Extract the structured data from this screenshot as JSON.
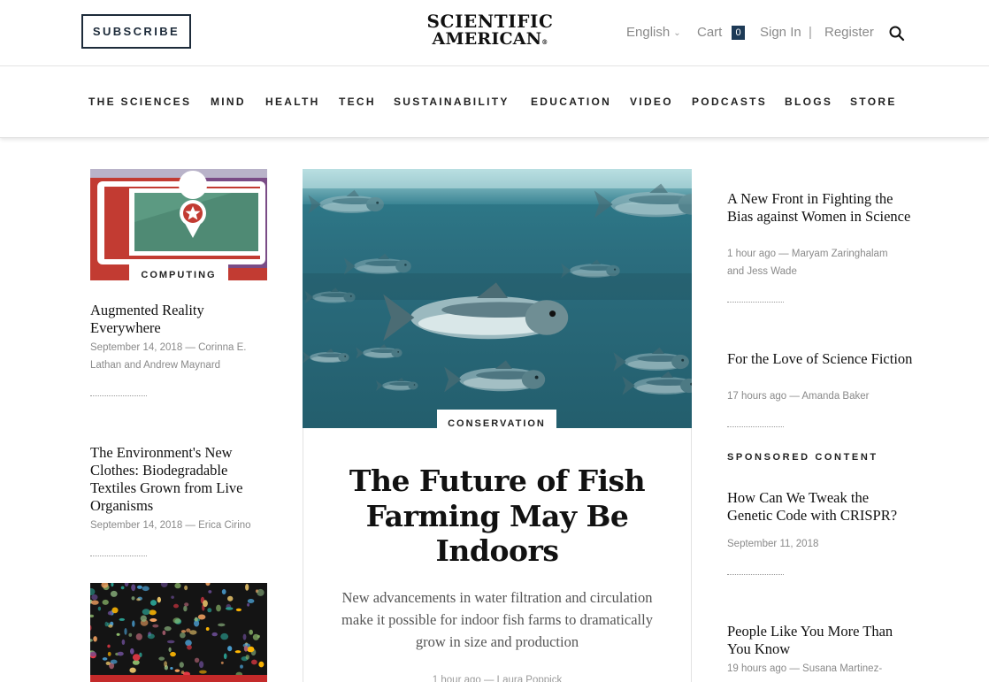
{
  "header": {
    "subscribe_label": "SUBSCRIBE",
    "logo_line1": "SCIENTIFIC",
    "logo_line2": "AMERICAN",
    "logo_mark": "®",
    "language": "English",
    "cart_label": "Cart",
    "cart_count": "0",
    "signin_label": "Sign In",
    "separator": "|",
    "register_label": "Register",
    "search_icon": "search-icon"
  },
  "nav": {
    "items": [
      "THE SCIENCES",
      "MIND",
      "HEALTH",
      "TECH",
      "SUSTAINABILITY",
      "EDUCATION",
      "VIDEO",
      "PODCASTS",
      "BLOGS",
      "STORE"
    ]
  },
  "left_column": {
    "articles": [
      {
        "kicker": "COMPUTING",
        "title": "Augmented Reality Everywhere",
        "meta": "September 14, 2018 — Corinna E. Lathan and Andrew Maynard"
      },
      {
        "title": "The Environment's New Clothes: Biodegradable Textiles Grown from Live Organisms",
        "meta": "September 14, 2018 — Erica Cirino"
      }
    ]
  },
  "feature": {
    "kicker": "CONSERVATION",
    "title": "The Future of Fish Farming May Be Indoors",
    "dek": "New advancements in water filtration and circulation make it possible for indoor fish farms to dramatically grow in size and production",
    "meta": "1 hour ago — Laura Poppick"
  },
  "right_column": {
    "articles": [
      {
        "title": "A New Front in Fighting the Bias against Women in Science",
        "meta": "1 hour ago — Maryam Zaringhalam and Jess Wade"
      },
      {
        "title": "For the Love of Science Fiction",
        "meta": "17 hours ago — Amanda Baker"
      }
    ],
    "sponsored_label": "SPONSORED CONTENT",
    "sponsored": [
      {
        "title": "How Can We Tweak the Genetic Code with CRISPR?",
        "meta": "September 11, 2018"
      },
      {
        "title": "People Like You More Than You Know",
        "meta": "19 hours ago — Susana Martinez-"
      }
    ]
  },
  "colors": {
    "brand_navy": "#1d2b3a",
    "badge": "#1d3a56",
    "ocean": "#2b6f80"
  }
}
